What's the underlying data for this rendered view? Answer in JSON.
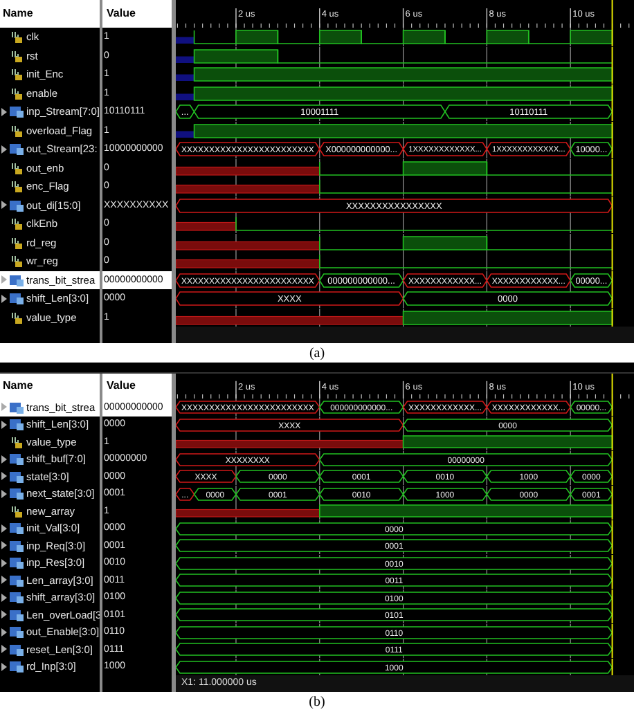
{
  "panels": [
    {
      "columns": [
        "Name",
        "Value"
      ],
      "ticks": [
        "2 us",
        "4 us",
        "6 us",
        "8 us",
        "10 us"
      ],
      "caption": "(a)",
      "signals": [
        {
          "name": "clk",
          "value": "1",
          "kind": "bit",
          "selected": false,
          "wave": [
            {
              "kind": "blue"
            },
            {
              "kind": "low"
            },
            {
              "kind": "high"
            },
            {
              "kind": "low"
            },
            {
              "kind": "high"
            },
            {
              "kind": "low"
            },
            {
              "kind": "high"
            },
            {
              "kind": "low"
            },
            {
              "kind": "high"
            },
            {
              "kind": "low"
            },
            {
              "kind": "high"
            }
          ]
        },
        {
          "name": "rst",
          "value": "0",
          "kind": "bit",
          "selected": false,
          "wave": [
            {
              "kind": "blue"
            },
            {
              "kind": "high"
            },
            {
              "kind": "hold"
            },
            {
              "kind": "low"
            },
            {
              "kind": "hold"
            },
            {
              "kind": "hold"
            },
            {
              "kind": "hold"
            },
            {
              "kind": "hold"
            },
            {
              "kind": "hold"
            },
            {
              "kind": "hold"
            },
            {
              "kind": "hold"
            }
          ]
        },
        {
          "name": "init_Enc",
          "value": "1",
          "kind": "bit",
          "selected": false,
          "wave": [
            {
              "kind": "blue"
            },
            {
              "kind": "high"
            },
            {
              "kind": "hold"
            },
            {
              "kind": "hold"
            },
            {
              "kind": "hold"
            },
            {
              "kind": "hold"
            },
            {
              "kind": "hold"
            },
            {
              "kind": "hold"
            },
            {
              "kind": "hold"
            },
            {
              "kind": "hold"
            },
            {
              "kind": "hold"
            }
          ]
        },
        {
          "name": "enable",
          "value": "1",
          "kind": "bit",
          "selected": false,
          "wave": [
            {
              "kind": "blue"
            },
            {
              "kind": "high"
            },
            {
              "kind": "hold"
            },
            {
              "kind": "hold"
            },
            {
              "kind": "hold"
            },
            {
              "kind": "hold"
            },
            {
              "kind": "hold"
            },
            {
              "kind": "hold"
            },
            {
              "kind": "hold"
            },
            {
              "kind": "hold"
            },
            {
              "kind": "hold"
            }
          ]
        },
        {
          "name": "inp_Stream[7:0]",
          "value": "10110111",
          "kind": "bus",
          "selected": false,
          "wave": [
            {
              "kind": "bus",
              "label": "..."
            },
            {
              "kind": "bus",
              "label": "10001111"
            },
            {
              "kind": "hold"
            },
            {
              "kind": "hold"
            },
            {
              "kind": "hold"
            },
            {
              "kind": "hold"
            },
            {
              "kind": "hold"
            },
            {
              "kind": "bus",
              "label": "10110111"
            },
            {
              "kind": "hold"
            },
            {
              "kind": "hold"
            },
            {
              "kind": "hold"
            }
          ]
        },
        {
          "name": "overload_Flag",
          "value": "1",
          "kind": "bit",
          "selected": false,
          "wave": [
            {
              "kind": "blue"
            },
            {
              "kind": "high"
            },
            {
              "kind": "hold"
            },
            {
              "kind": "hold"
            },
            {
              "kind": "hold"
            },
            {
              "kind": "hold"
            },
            {
              "kind": "hold"
            },
            {
              "kind": "hold"
            },
            {
              "kind": "hold"
            },
            {
              "kind": "hold"
            },
            {
              "kind": "hold"
            }
          ]
        },
        {
          "name": "out_Stream[23:",
          "value": "10000000000",
          "kind": "bus",
          "selected": false,
          "wave": [
            {
              "kind": "xbus",
              "label": "XXXXXXXXXXXXXXXXXXXXXXXX"
            },
            {
              "kind": "hold"
            },
            {
              "kind": "hold"
            },
            {
              "kind": "hold"
            },
            {
              "kind": "xbus",
              "label": "X000000000000..."
            },
            {
              "kind": "hold"
            },
            {
              "kind": "xbus",
              "label": "1XXXXXXXXXXXX..."
            },
            {
              "kind": "hold"
            },
            {
              "kind": "xbus",
              "label": "1XXXXXXXXXXXX..."
            },
            {
              "kind": "hold"
            },
            {
              "kind": "bus",
              "label": "10000..."
            }
          ]
        },
        {
          "name": "out_enb",
          "value": "0",
          "kind": "bit",
          "selected": false,
          "wave": [
            {
              "kind": "undefined"
            },
            {
              "kind": "hold"
            },
            {
              "kind": "hold"
            },
            {
              "kind": "hold"
            },
            {
              "kind": "low"
            },
            {
              "kind": "hold"
            },
            {
              "kind": "high"
            },
            {
              "kind": "hold"
            },
            {
              "kind": "low"
            },
            {
              "kind": "hold"
            },
            {
              "kind": "hold"
            }
          ]
        },
        {
          "name": "enc_Flag",
          "value": "0",
          "kind": "bit",
          "selected": false,
          "wave": [
            {
              "kind": "undefined"
            },
            {
              "kind": "hold"
            },
            {
              "kind": "hold"
            },
            {
              "kind": "hold"
            },
            {
              "kind": "low"
            },
            {
              "kind": "hold"
            },
            {
              "kind": "hold"
            },
            {
              "kind": "hold"
            },
            {
              "kind": "hold"
            },
            {
              "kind": "hold"
            },
            {
              "kind": "hold"
            }
          ]
        },
        {
          "name": "out_di[15:0]",
          "value": "XXXXXXXXXX",
          "kind": "bus",
          "selected": false,
          "wave": [
            {
              "kind": "xbus",
              "label": "XXXXXXXXXXXXXXXX"
            },
            {
              "kind": "hold"
            },
            {
              "kind": "hold"
            },
            {
              "kind": "hold"
            },
            {
              "kind": "hold"
            },
            {
              "kind": "hold"
            },
            {
              "kind": "hold"
            },
            {
              "kind": "hold"
            },
            {
              "kind": "hold"
            },
            {
              "kind": "hold"
            },
            {
              "kind": "hold"
            }
          ]
        },
        {
          "name": "clkEnb",
          "value": "0",
          "kind": "bit",
          "selected": false,
          "wave": [
            {
              "kind": "undefined"
            },
            {
              "kind": "hold"
            },
            {
              "kind": "low"
            },
            {
              "kind": "hold"
            },
            {
              "kind": "hold"
            },
            {
              "kind": "hold"
            },
            {
              "kind": "hold"
            },
            {
              "kind": "hold"
            },
            {
              "kind": "hold"
            },
            {
              "kind": "hold"
            },
            {
              "kind": "hold"
            }
          ]
        },
        {
          "name": "rd_reg",
          "value": "0",
          "kind": "bit",
          "selected": false,
          "wave": [
            {
              "kind": "undefined"
            },
            {
              "kind": "hold"
            },
            {
              "kind": "hold"
            },
            {
              "kind": "hold"
            },
            {
              "kind": "low"
            },
            {
              "kind": "hold"
            },
            {
              "kind": "high"
            },
            {
              "kind": "hold"
            },
            {
              "kind": "low"
            },
            {
              "kind": "hold"
            },
            {
              "kind": "hold"
            }
          ]
        },
        {
          "name": "wr_reg",
          "value": "0",
          "kind": "bit",
          "selected": false,
          "wave": [
            {
              "kind": "undefined"
            },
            {
              "kind": "hold"
            },
            {
              "kind": "hold"
            },
            {
              "kind": "hold"
            },
            {
              "kind": "low"
            },
            {
              "kind": "hold"
            },
            {
              "kind": "hold"
            },
            {
              "kind": "hold"
            },
            {
              "kind": "hold"
            },
            {
              "kind": "hold"
            },
            {
              "kind": "hold"
            }
          ]
        },
        {
          "name": "trans_bit_strea",
          "value": "00000000000",
          "kind": "bus",
          "selected": true,
          "wave": [
            {
              "kind": "xbus",
              "label": "XXXXXXXXXXXXXXXXXXXXXXXX"
            },
            {
              "kind": "hold"
            },
            {
              "kind": "hold"
            },
            {
              "kind": "hold"
            },
            {
              "kind": "bus",
              "label": "000000000000..."
            },
            {
              "kind": "hold"
            },
            {
              "kind": "xbus",
              "label": "XXXXXXXXXXXX..."
            },
            {
              "kind": "hold"
            },
            {
              "kind": "xbus",
              "label": "XXXXXXXXXXXX..."
            },
            {
              "kind": "hold"
            },
            {
              "kind": "bus",
              "label": "00000..."
            }
          ]
        },
        {
          "name": "shift_Len[3:0]",
          "value": "0000",
          "kind": "bus",
          "selected": false,
          "wave": [
            {
              "kind": "xbus",
              "label": "XXXX"
            },
            {
              "kind": "hold"
            },
            {
              "kind": "hold"
            },
            {
              "kind": "hold"
            },
            {
              "kind": "hold"
            },
            {
              "kind": "hold"
            },
            {
              "kind": "bus",
              "label": "0000"
            },
            {
              "kind": "hold"
            },
            {
              "kind": "hold"
            },
            {
              "kind": "hold"
            },
            {
              "kind": "hold"
            }
          ]
        },
        {
          "name": "value_type",
          "value": "1",
          "kind": "bit",
          "selected": false,
          "wave": [
            {
              "kind": "undefined"
            },
            {
              "kind": "hold"
            },
            {
              "kind": "hold"
            },
            {
              "kind": "hold"
            },
            {
              "kind": "hold"
            },
            {
              "kind": "hold"
            },
            {
              "kind": "high"
            },
            {
              "kind": "hold"
            },
            {
              "kind": "hold"
            },
            {
              "kind": "hold"
            },
            {
              "kind": "hold"
            }
          ]
        }
      ]
    },
    {
      "columns": [
        "Name",
        "Value"
      ],
      "ticks": [
        "2 us",
        "4 us",
        "6 us",
        "8 us",
        "10 us"
      ],
      "caption": "(b)",
      "status": "X1: 11.000000 us",
      "signals": [
        {
          "name": "trans_bit_strea",
          "value": "00000000000",
          "kind": "bus",
          "selected": true,
          "wave": [
            {
              "kind": "xbus",
              "label": "XXXXXXXXXXXXXXXXXXXXXXXX"
            },
            {
              "kind": "hold"
            },
            {
              "kind": "hold"
            },
            {
              "kind": "hold"
            },
            {
              "kind": "bus",
              "label": "000000000000..."
            },
            {
              "kind": "hold"
            },
            {
              "kind": "xbus",
              "label": "XXXXXXXXXXXX..."
            },
            {
              "kind": "hold"
            },
            {
              "kind": "xbus",
              "label": "XXXXXXXXXXXX..."
            },
            {
              "kind": "hold"
            },
            {
              "kind": "bus",
              "label": "00000..."
            }
          ]
        },
        {
          "name": "shift_Len[3:0]",
          "value": "0000",
          "kind": "bus",
          "selected": false,
          "wave": [
            {
              "kind": "xbus",
              "label": "XXXX"
            },
            {
              "kind": "hold"
            },
            {
              "kind": "hold"
            },
            {
              "kind": "hold"
            },
            {
              "kind": "hold"
            },
            {
              "kind": "hold"
            },
            {
              "kind": "bus",
              "label": "0000"
            },
            {
              "kind": "hold"
            },
            {
              "kind": "hold"
            },
            {
              "kind": "hold"
            },
            {
              "kind": "hold"
            }
          ]
        },
        {
          "name": "value_type",
          "value": "1",
          "kind": "bit",
          "selected": false,
          "wave": [
            {
              "kind": "undefined"
            },
            {
              "kind": "hold"
            },
            {
              "kind": "hold"
            },
            {
              "kind": "hold"
            },
            {
              "kind": "hold"
            },
            {
              "kind": "hold"
            },
            {
              "kind": "high"
            },
            {
              "kind": "hold"
            },
            {
              "kind": "hold"
            },
            {
              "kind": "hold"
            },
            {
              "kind": "hold"
            }
          ]
        },
        {
          "name": "shift_buf[7:0]",
          "value": "00000000",
          "kind": "bus",
          "selected": false,
          "wave": [
            {
              "kind": "xbus",
              "label": "XXXXXXXX"
            },
            {
              "kind": "hold"
            },
            {
              "kind": "hold"
            },
            {
              "kind": "hold"
            },
            {
              "kind": "bus",
              "label": "00000000"
            },
            {
              "kind": "hold"
            },
            {
              "kind": "hold"
            },
            {
              "kind": "hold"
            },
            {
              "kind": "hold"
            },
            {
              "kind": "hold"
            },
            {
              "kind": "hold"
            }
          ]
        },
        {
          "name": "state[3:0]",
          "value": "0000",
          "kind": "bus",
          "selected": false,
          "wave": [
            {
              "kind": "xbus",
              "label": "XXXX"
            },
            {
              "kind": "hold"
            },
            {
              "kind": "bus",
              "label": "0000"
            },
            {
              "kind": "hold"
            },
            {
              "kind": "bus",
              "label": "0001"
            },
            {
              "kind": "hold"
            },
            {
              "kind": "bus",
              "label": "0010"
            },
            {
              "kind": "hold"
            },
            {
              "kind": "bus",
              "label": "1000"
            },
            {
              "kind": "hold"
            },
            {
              "kind": "bus",
              "label": "0000"
            }
          ]
        },
        {
          "name": "next_state[3:0]",
          "value": "0001",
          "kind": "bus",
          "selected": false,
          "wave": [
            {
              "kind": "xbus",
              "label": "..."
            },
            {
              "kind": "bus",
              "label": "0000"
            },
            {
              "kind": "bus",
              "label": "0001"
            },
            {
              "kind": "hold"
            },
            {
              "kind": "bus",
              "label": "0010"
            },
            {
              "kind": "hold"
            },
            {
              "kind": "bus",
              "label": "1000"
            },
            {
              "kind": "hold"
            },
            {
              "kind": "bus",
              "label": "0000"
            },
            {
              "kind": "hold"
            },
            {
              "kind": "bus",
              "label": "0001"
            }
          ]
        },
        {
          "name": "new_array",
          "value": "1",
          "kind": "bit",
          "selected": false,
          "wave": [
            {
              "kind": "undefined"
            },
            {
              "kind": "hold"
            },
            {
              "kind": "hold"
            },
            {
              "kind": "hold"
            },
            {
              "kind": "high"
            },
            {
              "kind": "hold"
            },
            {
              "kind": "hold"
            },
            {
              "kind": "hold"
            },
            {
              "kind": "hold"
            },
            {
              "kind": "hold"
            },
            {
              "kind": "hold"
            }
          ]
        },
        {
          "name": "init_Val[3:0]",
          "value": "0000",
          "kind": "bus",
          "selected": false,
          "wave": [
            {
              "kind": "bus",
              "label": "0000"
            },
            {
              "kind": "hold"
            },
            {
              "kind": "hold"
            },
            {
              "kind": "hold"
            },
            {
              "kind": "hold"
            },
            {
              "kind": "hold"
            },
            {
              "kind": "hold"
            },
            {
              "kind": "hold"
            },
            {
              "kind": "hold"
            },
            {
              "kind": "hold"
            },
            {
              "kind": "hold"
            }
          ]
        },
        {
          "name": "inp_Req[3:0]",
          "value": "0001",
          "kind": "bus",
          "selected": false,
          "wave": [
            {
              "kind": "bus",
              "label": "0001"
            },
            {
              "kind": "hold"
            },
            {
              "kind": "hold"
            },
            {
              "kind": "hold"
            },
            {
              "kind": "hold"
            },
            {
              "kind": "hold"
            },
            {
              "kind": "hold"
            },
            {
              "kind": "hold"
            },
            {
              "kind": "hold"
            },
            {
              "kind": "hold"
            },
            {
              "kind": "hold"
            }
          ]
        },
        {
          "name": "inp_Res[3:0]",
          "value": "0010",
          "kind": "bus",
          "selected": false,
          "wave": [
            {
              "kind": "bus",
              "label": "0010"
            },
            {
              "kind": "hold"
            },
            {
              "kind": "hold"
            },
            {
              "kind": "hold"
            },
            {
              "kind": "hold"
            },
            {
              "kind": "hold"
            },
            {
              "kind": "hold"
            },
            {
              "kind": "hold"
            },
            {
              "kind": "hold"
            },
            {
              "kind": "hold"
            },
            {
              "kind": "hold"
            }
          ]
        },
        {
          "name": "Len_array[3:0]",
          "value": "0011",
          "kind": "bus",
          "selected": false,
          "wave": [
            {
              "kind": "bus",
              "label": "0011"
            },
            {
              "kind": "hold"
            },
            {
              "kind": "hold"
            },
            {
              "kind": "hold"
            },
            {
              "kind": "hold"
            },
            {
              "kind": "hold"
            },
            {
              "kind": "hold"
            },
            {
              "kind": "hold"
            },
            {
              "kind": "hold"
            },
            {
              "kind": "hold"
            },
            {
              "kind": "hold"
            }
          ]
        },
        {
          "name": "shift_array[3:0]",
          "value": "0100",
          "kind": "bus",
          "selected": false,
          "wave": [
            {
              "kind": "bus",
              "label": "0100"
            },
            {
              "kind": "hold"
            },
            {
              "kind": "hold"
            },
            {
              "kind": "hold"
            },
            {
              "kind": "hold"
            },
            {
              "kind": "hold"
            },
            {
              "kind": "hold"
            },
            {
              "kind": "hold"
            },
            {
              "kind": "hold"
            },
            {
              "kind": "hold"
            },
            {
              "kind": "hold"
            }
          ]
        },
        {
          "name": "Len_overLoad[3",
          "value": "0101",
          "kind": "bus",
          "selected": false,
          "wave": [
            {
              "kind": "bus",
              "label": "0101"
            },
            {
              "kind": "hold"
            },
            {
              "kind": "hold"
            },
            {
              "kind": "hold"
            },
            {
              "kind": "hold"
            },
            {
              "kind": "hold"
            },
            {
              "kind": "hold"
            },
            {
              "kind": "hold"
            },
            {
              "kind": "hold"
            },
            {
              "kind": "hold"
            },
            {
              "kind": "hold"
            }
          ]
        },
        {
          "name": "out_Enable[3:0]",
          "value": "0110",
          "kind": "bus",
          "selected": false,
          "wave": [
            {
              "kind": "bus",
              "label": "0110"
            },
            {
              "kind": "hold"
            },
            {
              "kind": "hold"
            },
            {
              "kind": "hold"
            },
            {
              "kind": "hold"
            },
            {
              "kind": "hold"
            },
            {
              "kind": "hold"
            },
            {
              "kind": "hold"
            },
            {
              "kind": "hold"
            },
            {
              "kind": "hold"
            },
            {
              "kind": "hold"
            }
          ]
        },
        {
          "name": "reset_Len[3:0]",
          "value": "0111",
          "kind": "bus",
          "selected": false,
          "wave": [
            {
              "kind": "bus",
              "label": "0111"
            },
            {
              "kind": "hold"
            },
            {
              "kind": "hold"
            },
            {
              "kind": "hold"
            },
            {
              "kind": "hold"
            },
            {
              "kind": "hold"
            },
            {
              "kind": "hold"
            },
            {
              "kind": "hold"
            },
            {
              "kind": "hold"
            },
            {
              "kind": "hold"
            },
            {
              "kind": "hold"
            }
          ]
        },
        {
          "name": "rd_Inp[3:0]",
          "value": "1000",
          "kind": "bus",
          "selected": false,
          "wave": [
            {
              "kind": "bus",
              "label": "1000"
            },
            {
              "kind": "hold"
            },
            {
              "kind": "hold"
            },
            {
              "kind": "hold"
            },
            {
              "kind": "hold"
            },
            {
              "kind": "hold"
            },
            {
              "kind": "hold"
            },
            {
              "kind": "hold"
            },
            {
              "kind": "hold"
            },
            {
              "kind": "hold"
            },
            {
              "kind": "hold"
            }
          ]
        }
      ]
    }
  ]
}
